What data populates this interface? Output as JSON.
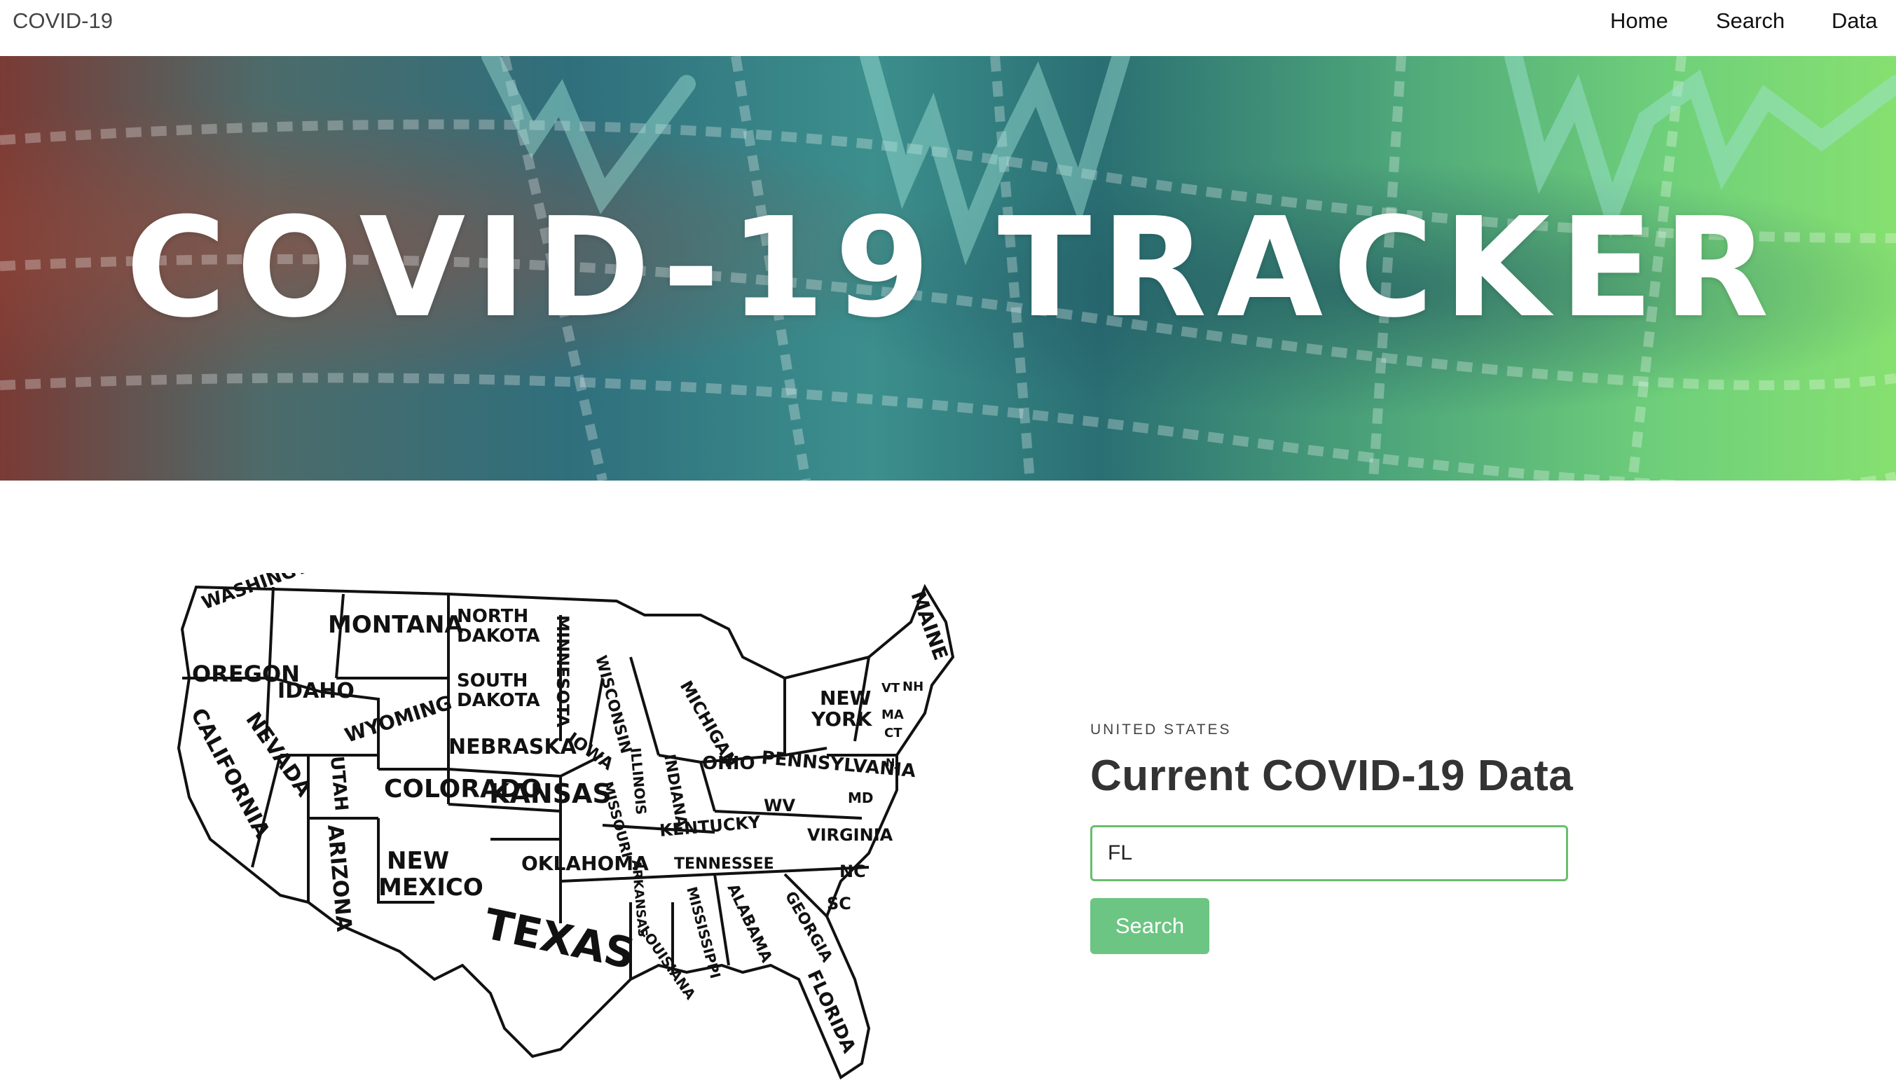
{
  "nav": {
    "brand": "COVID-19",
    "links": [
      "Home",
      "Search",
      "Data"
    ]
  },
  "hero": {
    "title": "COVID-19 TRACKER"
  },
  "map": {
    "state_labels": [
      "WASHINGTON",
      "MONTANA",
      "NORTH",
      "DAKOTA",
      "MINNESOTA",
      "MAINE",
      "OREGON",
      "IDAHO",
      "SOUTH",
      "DAKOTA",
      "WISCONSIN",
      "MICHIGAN",
      "NEW",
      "YORK",
      "VT",
      "NH",
      "MA",
      "CT",
      "WYOMING",
      "NEBRASKA",
      "IOWA",
      "CALIFORNIA",
      "NEVADA",
      "UTAH",
      "COLORADO",
      "KANSAS",
      "ILLINOIS",
      "INDIANA",
      "OHIO",
      "PENNSYLVANIA",
      "NJ",
      "MISSOURI",
      "WV",
      "MD",
      "KENTUCKY",
      "VIRGINIA",
      "ARIZONA",
      "NEW",
      "MEXICO",
      "OKLAHOMA",
      "ARKANSAS",
      "TENNESSEE",
      "NC",
      "SC",
      "TEXAS",
      "MISSISSIPPI",
      "ALABAMA",
      "GEORGIA",
      "LOUISIANA",
      "FLORIDA"
    ]
  },
  "form": {
    "eyebrow": "UNITED STATES",
    "heading": "Current COVID-19 Data",
    "input_value": "FL",
    "button_label": "Search"
  },
  "colors": {
    "accent": "#6cc583",
    "input_border": "#6abd6f"
  }
}
